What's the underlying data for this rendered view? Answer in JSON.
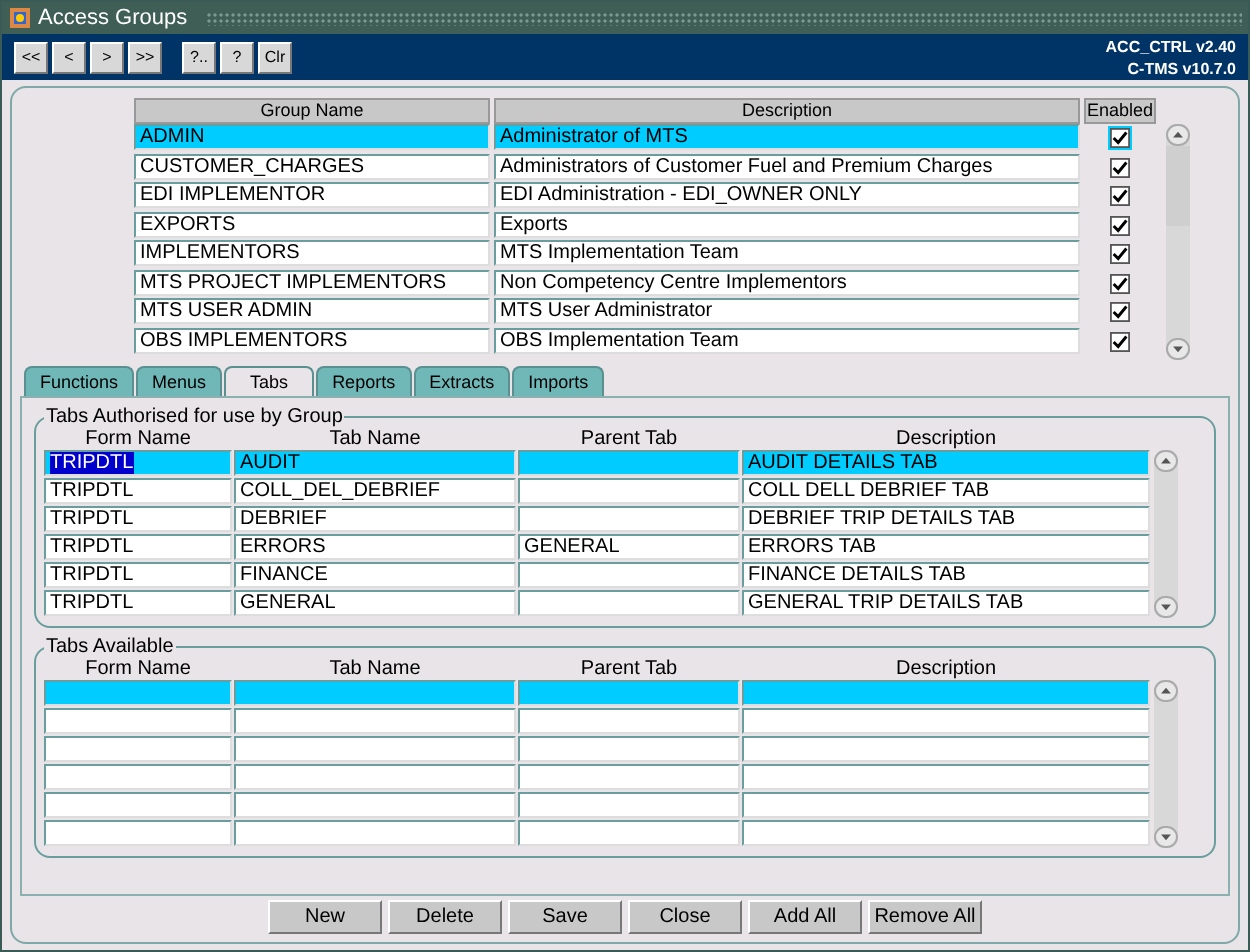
{
  "window": {
    "title": "Access Groups"
  },
  "toolbar": {
    "buttons": [
      "<<",
      "<",
      ">",
      ">>"
    ],
    "help_buttons": [
      "?..",
      "?",
      "Clr"
    ],
    "version_lines": [
      "ACC_CTRL v2.40",
      "C-TMS v10.7.0"
    ]
  },
  "groups": {
    "columns": [
      "Group Name",
      "Description",
      "Enabled"
    ],
    "rows": [
      {
        "name": "ADMIN",
        "description": "Administrator of MTS",
        "enabled": true,
        "selected": true
      },
      {
        "name": "CUSTOMER_CHARGES",
        "description": "Administrators of Customer Fuel and Premium Charges",
        "enabled": true,
        "selected": false
      },
      {
        "name": "EDI IMPLEMENTOR",
        "description": "EDI Administration - EDI_OWNER ONLY",
        "enabled": true,
        "selected": false
      },
      {
        "name": "EXPORTS",
        "description": "Exports",
        "enabled": true,
        "selected": false
      },
      {
        "name": "IMPLEMENTORS",
        "description": "MTS Implementation Team",
        "enabled": true,
        "selected": false
      },
      {
        "name": "MTS PROJECT IMPLEMENTORS",
        "description": "Non Competency Centre Implementors",
        "enabled": true,
        "selected": false
      },
      {
        "name": "MTS USER ADMIN",
        "description": "MTS User Administrator",
        "enabled": true,
        "selected": false
      },
      {
        "name": "OBS IMPLEMENTORS",
        "description": "OBS Implementation Team",
        "enabled": true,
        "selected": false
      }
    ]
  },
  "tabs": [
    {
      "label": "Functions",
      "selected": false
    },
    {
      "label": "Menus",
      "selected": false
    },
    {
      "label": "Tabs",
      "selected": true
    },
    {
      "label": "Reports",
      "selected": false
    },
    {
      "label": "Extracts",
      "selected": false
    },
    {
      "label": "Imports",
      "selected": false
    }
  ],
  "authorised": {
    "title": "Tabs Authorised for use by Group",
    "columns": [
      "Form Name",
      "Tab Name",
      "Parent Tab",
      "Description"
    ],
    "rows": [
      {
        "cells": [
          "TRIPDTL",
          "AUDIT",
          "",
          "AUDIT DETAILS TAB"
        ],
        "selected": true
      },
      {
        "cells": [
          "TRIPDTL",
          "COLL_DEL_DEBRIEF",
          "",
          "COLL DELL DEBRIEF TAB"
        ],
        "selected": false
      },
      {
        "cells": [
          "TRIPDTL",
          "DEBRIEF",
          "",
          "DEBRIEF TRIP DETAILS TAB"
        ],
        "selected": false
      },
      {
        "cells": [
          "TRIPDTL",
          "ERRORS",
          "GENERAL",
          "ERRORS TAB"
        ],
        "selected": false
      },
      {
        "cells": [
          "TRIPDTL",
          "FINANCE",
          "",
          "FINANCE DETAILS TAB"
        ],
        "selected": false
      },
      {
        "cells": [
          "TRIPDTL",
          "GENERAL",
          "",
          "GENERAL TRIP DETAILS TAB"
        ],
        "selected": false
      }
    ]
  },
  "available": {
    "title": "Tabs Available",
    "columns": [
      "Form Name",
      "Tab Name",
      "Parent Tab",
      "Description"
    ],
    "rows": [
      {
        "cells": [
          "",
          "",
          "",
          ""
        ],
        "selected": true
      },
      {
        "cells": [
          "",
          "",
          "",
          ""
        ],
        "selected": false
      },
      {
        "cells": [
          "",
          "",
          "",
          ""
        ],
        "selected": false
      },
      {
        "cells": [
          "",
          "",
          "",
          ""
        ],
        "selected": false
      },
      {
        "cells": [
          "",
          "",
          "",
          ""
        ],
        "selected": false
      },
      {
        "cells": [
          "",
          "",
          "",
          ""
        ],
        "selected": false
      }
    ]
  },
  "buttons": [
    "New",
    "Delete",
    "Save",
    "Close",
    "Add All",
    "Remove All"
  ]
}
